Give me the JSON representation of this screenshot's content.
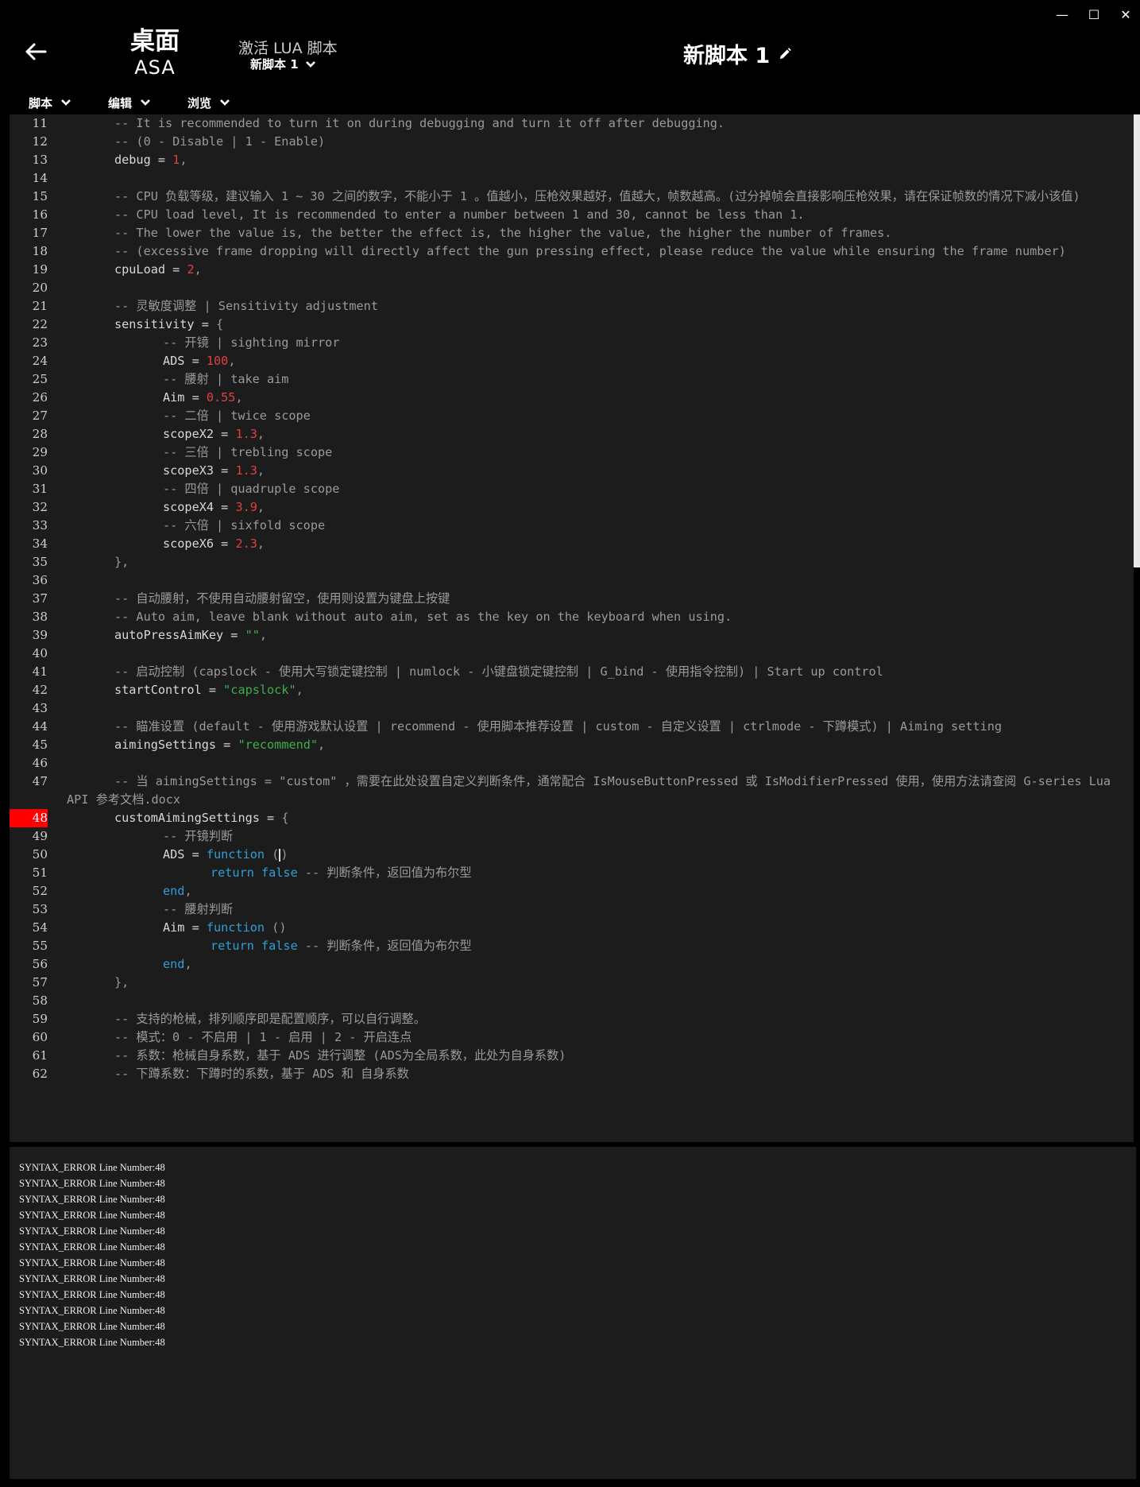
{
  "window": {
    "controls": [
      {
        "id": "minimize",
        "glyph": "—"
      },
      {
        "id": "maximize",
        "glyph": "☐"
      },
      {
        "id": "close",
        "glyph": "✕"
      }
    ]
  },
  "header": {
    "device_name": "桌面",
    "device_model": "ASA",
    "activate_label": "激活 LUA 脚本",
    "activate_selected": "新脚本 1",
    "script_title": "新脚本 1"
  },
  "menu": [
    {
      "id": "script",
      "label": "脚本"
    },
    {
      "id": "edit",
      "label": "编辑"
    },
    {
      "id": "browse",
      "label": "浏览"
    }
  ],
  "editor": {
    "error_line": "48",
    "lines": [
      {
        "n": "11",
        "indent": 1,
        "parts": [
          [
            "cmt",
            "-- It is recommended to turn it on during debugging and turn it off after debugging."
          ]
        ]
      },
      {
        "n": "12",
        "indent": 1,
        "parts": [
          [
            "cmt",
            "-- (0 - Disable | 1 - Enable)"
          ]
        ]
      },
      {
        "n": "13",
        "indent": 1,
        "parts": [
          [
            "txt",
            "debug = "
          ],
          [
            "num",
            "1"
          ],
          [
            "cmt",
            ","
          ]
        ]
      },
      {
        "n": "14",
        "indent": 0,
        "parts": []
      },
      {
        "n": "15",
        "indent": 1,
        "parts": [
          [
            "cmt",
            "-- CPU 负载等级，建议输入 1 ~ 30 之间的数字，不能小于 1 。值越小，压枪效果越好，值越大，帧数越高。(过分掉帧会直接影响压枪效果，请在保证帧数的情况下减小该值)"
          ]
        ]
      },
      {
        "n": "16",
        "indent": 1,
        "parts": [
          [
            "cmt",
            "-- CPU load level, It is recommended to enter a number between 1 and 30, cannot be less than 1."
          ]
        ]
      },
      {
        "n": "17",
        "indent": 1,
        "parts": [
          [
            "cmt",
            "-- The lower the value is, the better the effect is, the higher the value, the higher the number of frames."
          ]
        ]
      },
      {
        "n": "18",
        "indent": 1,
        "parts": [
          [
            "cmt",
            "-- (excessive frame dropping will directly affect the gun pressing effect, please reduce the value while ensuring the frame number)"
          ]
        ]
      },
      {
        "n": "19",
        "indent": 1,
        "parts": [
          [
            "txt",
            "cpuLoad = "
          ],
          [
            "num",
            "2"
          ],
          [
            "cmt",
            ","
          ]
        ]
      },
      {
        "n": "20",
        "indent": 0,
        "parts": []
      },
      {
        "n": "21",
        "indent": 1,
        "parts": [
          [
            "cmt",
            "-- 灵敏度调整 | Sensitivity adjustment"
          ]
        ]
      },
      {
        "n": "22",
        "indent": 1,
        "parts": [
          [
            "txt",
            "sensitivity = "
          ],
          [
            "cmt",
            "{"
          ]
        ]
      },
      {
        "n": "23",
        "indent": 2,
        "parts": [
          [
            "cmt",
            "-- 开镜 | sighting mirror"
          ]
        ]
      },
      {
        "n": "24",
        "indent": 2,
        "parts": [
          [
            "txt",
            "ADS = "
          ],
          [
            "num",
            "100"
          ],
          [
            "cmt",
            ","
          ]
        ]
      },
      {
        "n": "25",
        "indent": 2,
        "parts": [
          [
            "cmt",
            "-- 腰射 | take aim"
          ]
        ]
      },
      {
        "n": "26",
        "indent": 2,
        "parts": [
          [
            "txt",
            "Aim = "
          ],
          [
            "num",
            "0.55"
          ],
          [
            "cmt",
            ","
          ]
        ]
      },
      {
        "n": "27",
        "indent": 2,
        "parts": [
          [
            "cmt",
            "-- 二倍 | twice scope"
          ]
        ]
      },
      {
        "n": "28",
        "indent": 2,
        "parts": [
          [
            "txt",
            "scopeX2 = "
          ],
          [
            "num",
            "1.3"
          ],
          [
            "cmt",
            ","
          ]
        ]
      },
      {
        "n": "29",
        "indent": 2,
        "parts": [
          [
            "cmt",
            "-- 三倍 | trebling scope"
          ]
        ]
      },
      {
        "n": "30",
        "indent": 2,
        "parts": [
          [
            "txt",
            "scopeX3 = "
          ],
          [
            "num",
            "1.3"
          ],
          [
            "cmt",
            ","
          ]
        ]
      },
      {
        "n": "31",
        "indent": 2,
        "parts": [
          [
            "cmt",
            "-- 四倍 | quadruple scope"
          ]
        ]
      },
      {
        "n": "32",
        "indent": 2,
        "parts": [
          [
            "txt",
            "scopeX4 = "
          ],
          [
            "num",
            "3.9"
          ],
          [
            "cmt",
            ","
          ]
        ]
      },
      {
        "n": "33",
        "indent": 2,
        "parts": [
          [
            "cmt",
            "-- 六倍 | sixfold scope"
          ]
        ]
      },
      {
        "n": "34",
        "indent": 2,
        "parts": [
          [
            "txt",
            "scopeX6 = "
          ],
          [
            "num",
            "2.3"
          ],
          [
            "cmt",
            ","
          ]
        ]
      },
      {
        "n": "35",
        "indent": 1,
        "parts": [
          [
            "cmt",
            "},"
          ]
        ]
      },
      {
        "n": "36",
        "indent": 0,
        "parts": []
      },
      {
        "n": "37",
        "indent": 1,
        "parts": [
          [
            "cmt",
            "-- 自动腰射，不使用自动腰射留空，使用则设置为键盘上按键"
          ]
        ]
      },
      {
        "n": "38",
        "indent": 1,
        "parts": [
          [
            "cmt",
            "-- Auto aim, leave blank without auto aim, set as the key on the keyboard when using."
          ]
        ]
      },
      {
        "n": "39",
        "indent": 1,
        "parts": [
          [
            "txt",
            "autoPressAimKey = "
          ],
          [
            "str",
            "\"\""
          ],
          [
            "cmt",
            ","
          ]
        ]
      },
      {
        "n": "40",
        "indent": 0,
        "parts": []
      },
      {
        "n": "41",
        "indent": 1,
        "parts": [
          [
            "cmt",
            "-- 启动控制 (capslock - 使用大写锁定键控制 | numlock - 小键盘锁定键控制 | G_bind - 使用指令控制) | Start up control"
          ]
        ]
      },
      {
        "n": "42",
        "indent": 1,
        "parts": [
          [
            "txt",
            "startControl = "
          ],
          [
            "str",
            "\"capslock\""
          ],
          [
            "cmt",
            ","
          ]
        ]
      },
      {
        "n": "43",
        "indent": 0,
        "parts": []
      },
      {
        "n": "44",
        "indent": 1,
        "parts": [
          [
            "cmt",
            "-- 瞄准设置 (default - 使用游戏默认设置 | recommend - 使用脚本推荐设置 | custom - 自定义设置 | ctrlmode - 下蹲模式) | Aiming setting"
          ]
        ]
      },
      {
        "n": "45",
        "indent": 1,
        "parts": [
          [
            "txt",
            "aimingSettings = "
          ],
          [
            "str",
            "\"recommend\""
          ],
          [
            "cmt",
            ","
          ]
        ]
      },
      {
        "n": "46",
        "indent": 0,
        "parts": []
      },
      {
        "n": "47",
        "indent": 1,
        "parts": [
          [
            "cmt",
            "-- 当 aimingSettings = \"custom\" ，需要在此处设置自定义判断条件，通常配合 IsMouseButtonPressed 或 IsModifierPressed 使用，使用方法请查阅 G-series Lua API 参考文档.docx"
          ]
        ]
      },
      {
        "n": "48",
        "indent": 1,
        "parts": [
          [
            "txt",
            "customAimingSettings = "
          ],
          [
            "cmt",
            "{"
          ]
        ]
      },
      {
        "n": "49",
        "indent": 2,
        "parts": [
          [
            "cmt",
            "-- 开镜判断"
          ]
        ]
      },
      {
        "n": "50",
        "indent": 2,
        "parts": [
          [
            "txt",
            "ADS = "
          ],
          [
            "kw",
            "function"
          ],
          [
            "cmt",
            " ("
          ],
          [
            "cursor",
            ""
          ],
          [
            "cmt",
            ")"
          ]
        ]
      },
      {
        "n": "51",
        "indent": 3,
        "parts": [
          [
            "kw",
            "return false"
          ],
          [
            "cmt",
            " -- 判断条件，返回值为布尔型"
          ]
        ]
      },
      {
        "n": "52",
        "indent": 2,
        "parts": [
          [
            "kw",
            "end"
          ],
          [
            "cmt",
            ","
          ]
        ]
      },
      {
        "n": "53",
        "indent": 2,
        "parts": [
          [
            "cmt",
            "-- 腰射判断"
          ]
        ]
      },
      {
        "n": "54",
        "indent": 2,
        "parts": [
          [
            "txt",
            "Aim = "
          ],
          [
            "kw",
            "function"
          ],
          [
            "cmt",
            " ()"
          ]
        ]
      },
      {
        "n": "55",
        "indent": 3,
        "parts": [
          [
            "kw",
            "return false"
          ],
          [
            "cmt",
            " -- 判断条件，返回值为布尔型"
          ]
        ]
      },
      {
        "n": "56",
        "indent": 2,
        "parts": [
          [
            "kw",
            "end"
          ],
          [
            "cmt",
            ","
          ]
        ]
      },
      {
        "n": "57",
        "indent": 1,
        "parts": [
          [
            "cmt",
            "},"
          ]
        ]
      },
      {
        "n": "58",
        "indent": 0,
        "parts": []
      },
      {
        "n": "59",
        "indent": 1,
        "parts": [
          [
            "cmt",
            "-- 支持的枪械，排列顺序即是配置顺序，可以自行调整。"
          ]
        ]
      },
      {
        "n": "60",
        "indent": 1,
        "parts": [
          [
            "cmt",
            "-- 模式：0 - 不启用 | 1 - 启用 | 2 - 开启连点"
          ]
        ]
      },
      {
        "n": "61",
        "indent": 1,
        "parts": [
          [
            "cmt",
            "-- 系数：枪械自身系数，基于 ADS 进行调整 (ADS为全局系数，此处为自身系数)"
          ]
        ]
      },
      {
        "n": "62",
        "indent": 1,
        "parts": [
          [
            "cmt",
            "-- 下蹲系数：下蹲时的系数，基于 ADS 和 自身系数"
          ]
        ]
      }
    ]
  },
  "output": {
    "lines": [
      "SYNTAX_ERROR Line Number:48",
      "SYNTAX_ERROR Line Number:48",
      "SYNTAX_ERROR Line Number:48",
      "SYNTAX_ERROR Line Number:48",
      "SYNTAX_ERROR Line Number:48",
      "SYNTAX_ERROR Line Number:48",
      "SYNTAX_ERROR Line Number:48",
      "SYNTAX_ERROR Line Number:48",
      "SYNTAX_ERROR Line Number:48",
      "SYNTAX_ERROR Line Number:48",
      "SYNTAX_ERROR Line Number:48",
      "SYNTAX_ERROR Line Number:48"
    ]
  }
}
